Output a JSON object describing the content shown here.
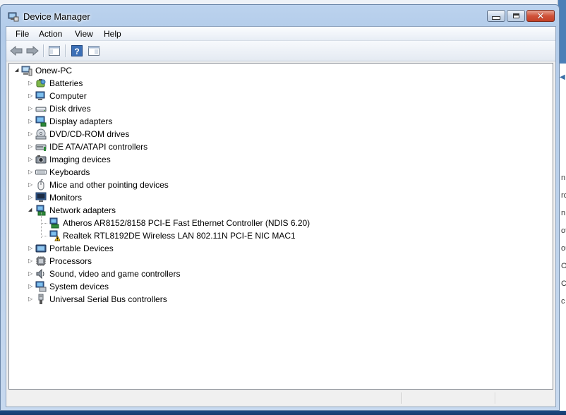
{
  "window": {
    "title": "Device Manager",
    "title_icon": "device-manager-icon"
  },
  "menu": {
    "items": [
      "File",
      "Action",
      "View",
      "Help"
    ]
  },
  "toolbar": {
    "buttons": [
      {
        "name": "back-icon"
      },
      {
        "name": "forward-icon"
      },
      {
        "name": "show-hide-console-tree-icon"
      },
      {
        "name": "help-icon"
      },
      {
        "name": "properties-pane-icon"
      }
    ]
  },
  "tree": {
    "root": {
      "label": "Onew-PC",
      "icon": "computer-root-icon",
      "expanded": true
    },
    "items": [
      {
        "label": "Batteries",
        "icon": "battery-icon",
        "expanded": false
      },
      {
        "label": "Computer",
        "icon": "computer-icon",
        "expanded": false
      },
      {
        "label": "Disk drives",
        "icon": "disk-drive-icon",
        "expanded": false
      },
      {
        "label": "Display adapters",
        "icon": "display-adapter-icon",
        "expanded": false
      },
      {
        "label": "DVD/CD-ROM drives",
        "icon": "dvd-drive-icon",
        "expanded": false
      },
      {
        "label": "IDE ATA/ATAPI controllers",
        "icon": "ide-controller-icon",
        "expanded": false
      },
      {
        "label": "Imaging devices",
        "icon": "imaging-device-icon",
        "expanded": false
      },
      {
        "label": "Keyboards",
        "icon": "keyboard-icon",
        "expanded": false
      },
      {
        "label": "Mice and other pointing devices",
        "icon": "mouse-icon",
        "expanded": false
      },
      {
        "label": "Monitors",
        "icon": "monitor-icon",
        "expanded": false
      },
      {
        "label": "Network adapters",
        "icon": "network-adapter-icon",
        "expanded": true,
        "children": [
          {
            "label": "Atheros AR8152/8158 PCI-E Fast Ethernet Controller (NDIS 6.20)",
            "icon": "network-adapter-icon",
            "warning": false
          },
          {
            "label": "Realtek RTL8192DE Wireless LAN 802.11N PCI-E NIC MAC1",
            "icon": "network-adapter-warning-icon",
            "warning": true
          }
        ]
      },
      {
        "label": "Portable Devices",
        "icon": "portable-device-icon",
        "expanded": false
      },
      {
        "label": "Processors",
        "icon": "processor-icon",
        "expanded": false
      },
      {
        "label": "Sound, video and game controllers",
        "icon": "sound-icon",
        "expanded": false
      },
      {
        "label": "System devices",
        "icon": "system-device-icon",
        "expanded": false
      },
      {
        "label": "Universal Serial Bus controllers",
        "icon": "usb-icon",
        "expanded": false
      }
    ]
  },
  "background_window": {
    "letters": [
      "n",
      "ro",
      "n",
      "ot",
      "ou",
      "Op",
      "C",
      "c"
    ]
  },
  "colors": {
    "warning": "#f0c020",
    "accent": "#3a6ea5"
  }
}
